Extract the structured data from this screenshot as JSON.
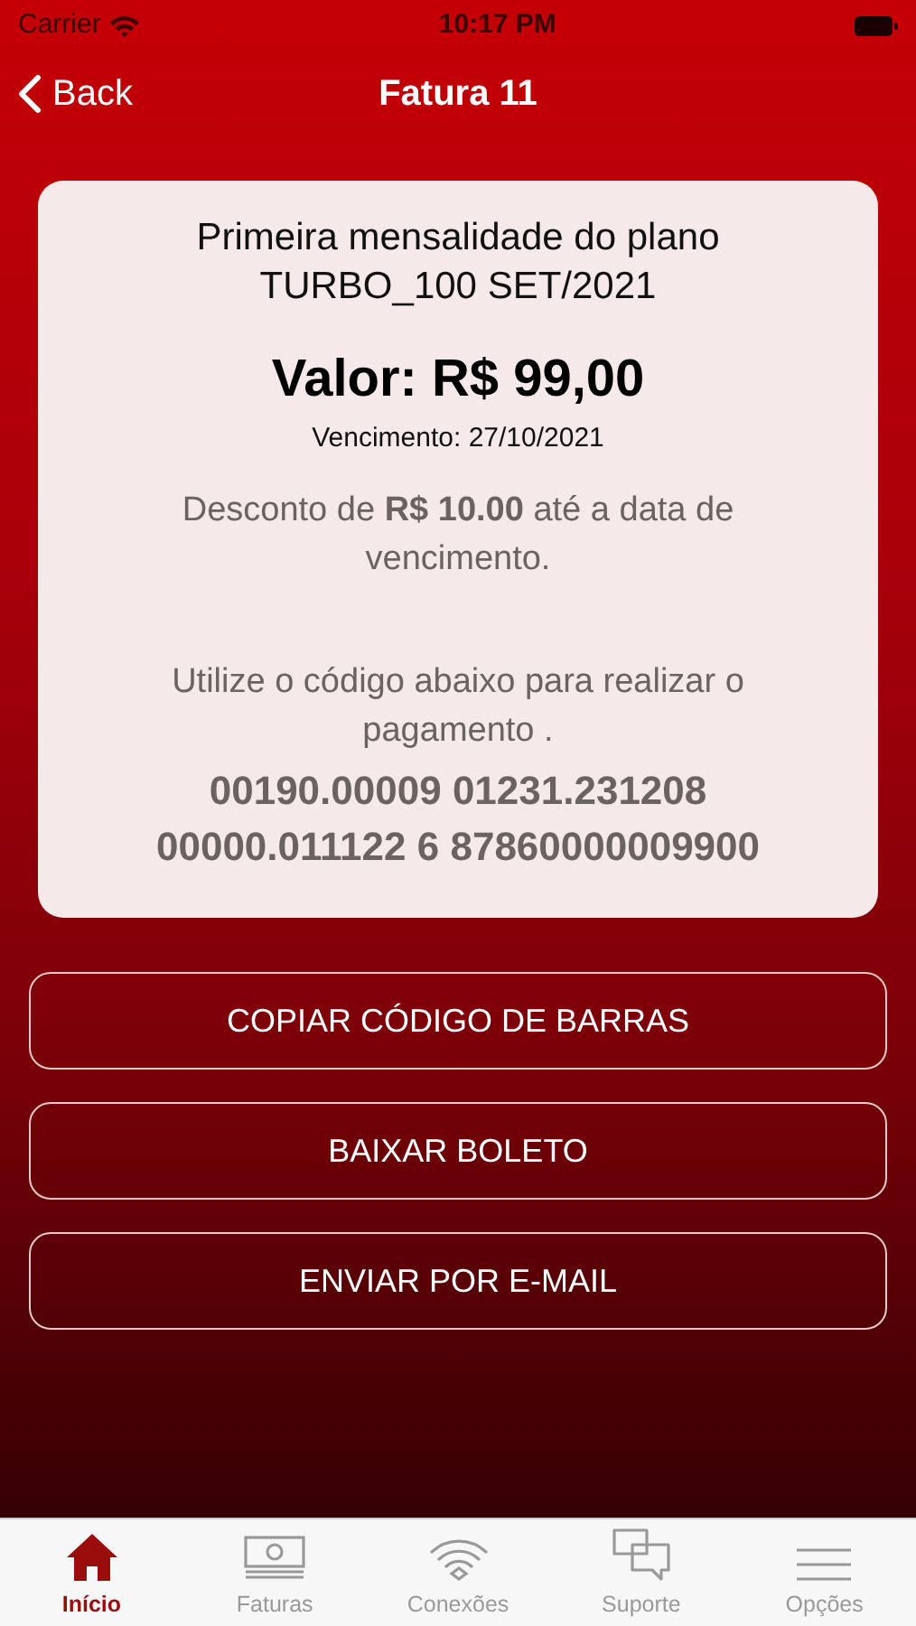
{
  "status_bar": {
    "carrier": "Carrier",
    "time": "10:17 PM"
  },
  "nav": {
    "back": "Back",
    "title": "Fatura 11"
  },
  "invoice": {
    "description": "Primeira mensalidade do plano TURBO_100 SET/2021",
    "amount": "Valor: R$ 99,00",
    "due": "Vencimento: 27/10/2021",
    "discount": "Desconto de **R$ 10.00** até a data de vencimento.",
    "instructions": "Utilize o código abaixo para realizar o pagamento .",
    "barcode": "00190.00009 01231.231208 00000.011122 6 87860000009900"
  },
  "buttons": [
    "COPIAR CÓDIGO DE BARRAS",
    "BAIXAR BOLETO",
    "ENVIAR POR E-MAIL"
  ],
  "tabs": [
    {
      "kind": "home",
      "label": "Início",
      "selected": true
    },
    {
      "kind": "money",
      "label": "Faturas",
      "selected": false
    },
    {
      "kind": "wifi",
      "label": "Conexões",
      "selected": false
    },
    {
      "kind": "chat",
      "label": "Suporte",
      "selected": false
    },
    {
      "kind": "menu",
      "label": "Opções",
      "selected": false
    }
  ]
}
